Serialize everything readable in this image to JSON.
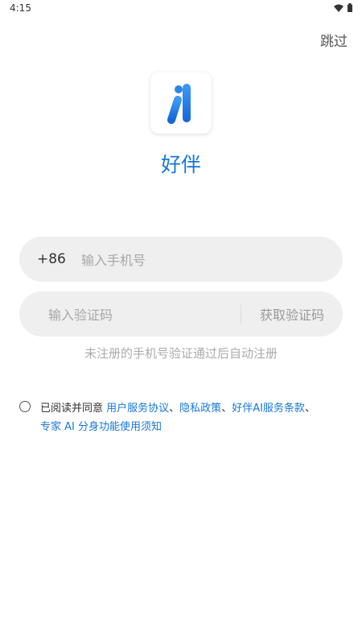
{
  "status_bar": {
    "time": "4:15",
    "icons": [
      "wifi-icon",
      "battery-icon"
    ]
  },
  "header": {
    "skip_label": "跳过"
  },
  "app": {
    "name": "好伴",
    "logo_icon": "app-logo-icon"
  },
  "login": {
    "country_code": "+86",
    "phone_placeholder": "输入手机号",
    "code_placeholder": "输入验证码",
    "get_code_label": "获取验证码",
    "register_hint": "未注册的手机号验证通过后自动注册"
  },
  "agreement": {
    "prefix": "已阅读并同意 ",
    "link_user_agreement": "用户服务协议",
    "sep1": "、",
    "link_privacy": "隐私政策",
    "sep2": "、",
    "link_ai_terms": "好伴AI服务条款",
    "sep3": "、",
    "link_expert": "专家 AI 分身功能使用须知"
  },
  "colors": {
    "accent": "#1677d8",
    "field_bg": "#efefef",
    "placeholder": "#a7a7a7"
  }
}
